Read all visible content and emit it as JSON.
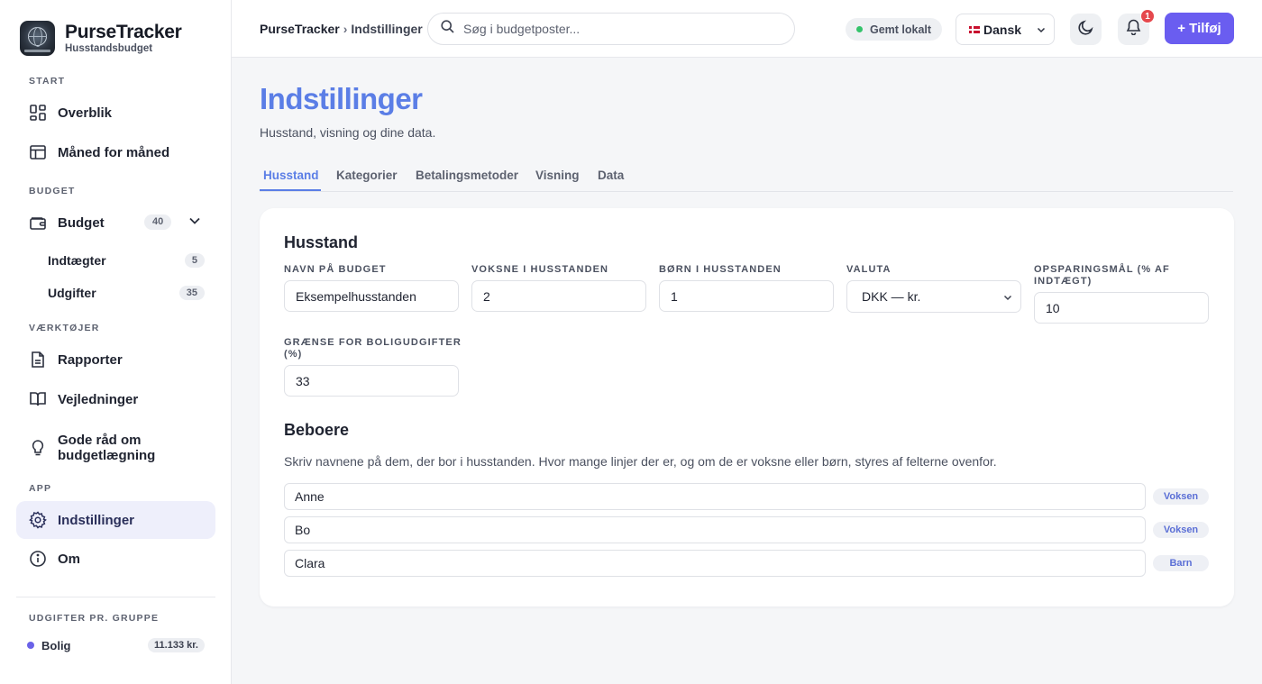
{
  "brand": {
    "title": "PurseTracker",
    "subtitle": "Husstandsbudget"
  },
  "sidebar": {
    "sections": {
      "start": "START",
      "budget": "BUDGET",
      "tools": "VÆRKTØJER",
      "app": "APP",
      "groups": "UDGIFTER PR. GRUPPE"
    },
    "items": {
      "overview": "Overblik",
      "monthly": "Måned for måned",
      "budget": "Budget",
      "budget_count": "40",
      "income": "Indtægter",
      "income_count": "5",
      "expenses": "Udgifter",
      "expenses_count": "35",
      "reports": "Rapporter",
      "guides": "Vejledninger",
      "tips_line1": "Gode råd om",
      "tips_line2": "budgetlægning",
      "settings": "Indstillinger",
      "about": "Om"
    },
    "group": {
      "name": "Bolig",
      "amount": "11.133 kr.",
      "color": "#6a62e8"
    }
  },
  "topbar": {
    "breadcrumb_root": "PurseTracker",
    "breadcrumb_sep": "›",
    "breadcrumb_current": "Indstillinger",
    "search_placeholder": "Søg i budgetposter...",
    "saved_status": "Gemt lokalt",
    "language": "Dansk",
    "notifications_count": "1",
    "add_label": "+ Tilføj"
  },
  "page": {
    "title": "Indstillinger",
    "subtitle": "Husstand, visning og dine data.",
    "tabs": [
      "Husstand",
      "Kategorier",
      "Betalingsmetoder",
      "Visning",
      "Data"
    ]
  },
  "household": {
    "heading": "Husstand",
    "fields": {
      "name_label": "Navn på budget",
      "name_value": "Eksempelhusstanden",
      "adults_label": "Voksne i husstanden",
      "adults_value": "2",
      "children_label": "Børn i husstanden",
      "children_value": "1",
      "currency_label": "Valuta",
      "currency_value": "DKK — kr.",
      "savings_label_line1": "Opsparingsmål (% af",
      "savings_label_line2": "indtægt)",
      "savings_value": "10",
      "housing_label_line1": "Grænse for boligudgifter",
      "housing_label_line2": "(%)",
      "housing_value": "33"
    }
  },
  "residents": {
    "heading": "Beboere",
    "help": "Skriv navnene på dem, der bor i husstanden. Hvor mange linjer der er, og om de er voksne eller børn, styres af felterne ovenfor.",
    "list": [
      {
        "name": "Anne",
        "role": "Voksen"
      },
      {
        "name": "Bo",
        "role": "Voksen"
      },
      {
        "name": "Clara",
        "role": "Barn"
      }
    ]
  },
  "colors": {
    "accent": "#5b7ee6",
    "primary_button": "#6a5df0",
    "saved_dot": "#34c36b",
    "notification": "#e5484d"
  }
}
